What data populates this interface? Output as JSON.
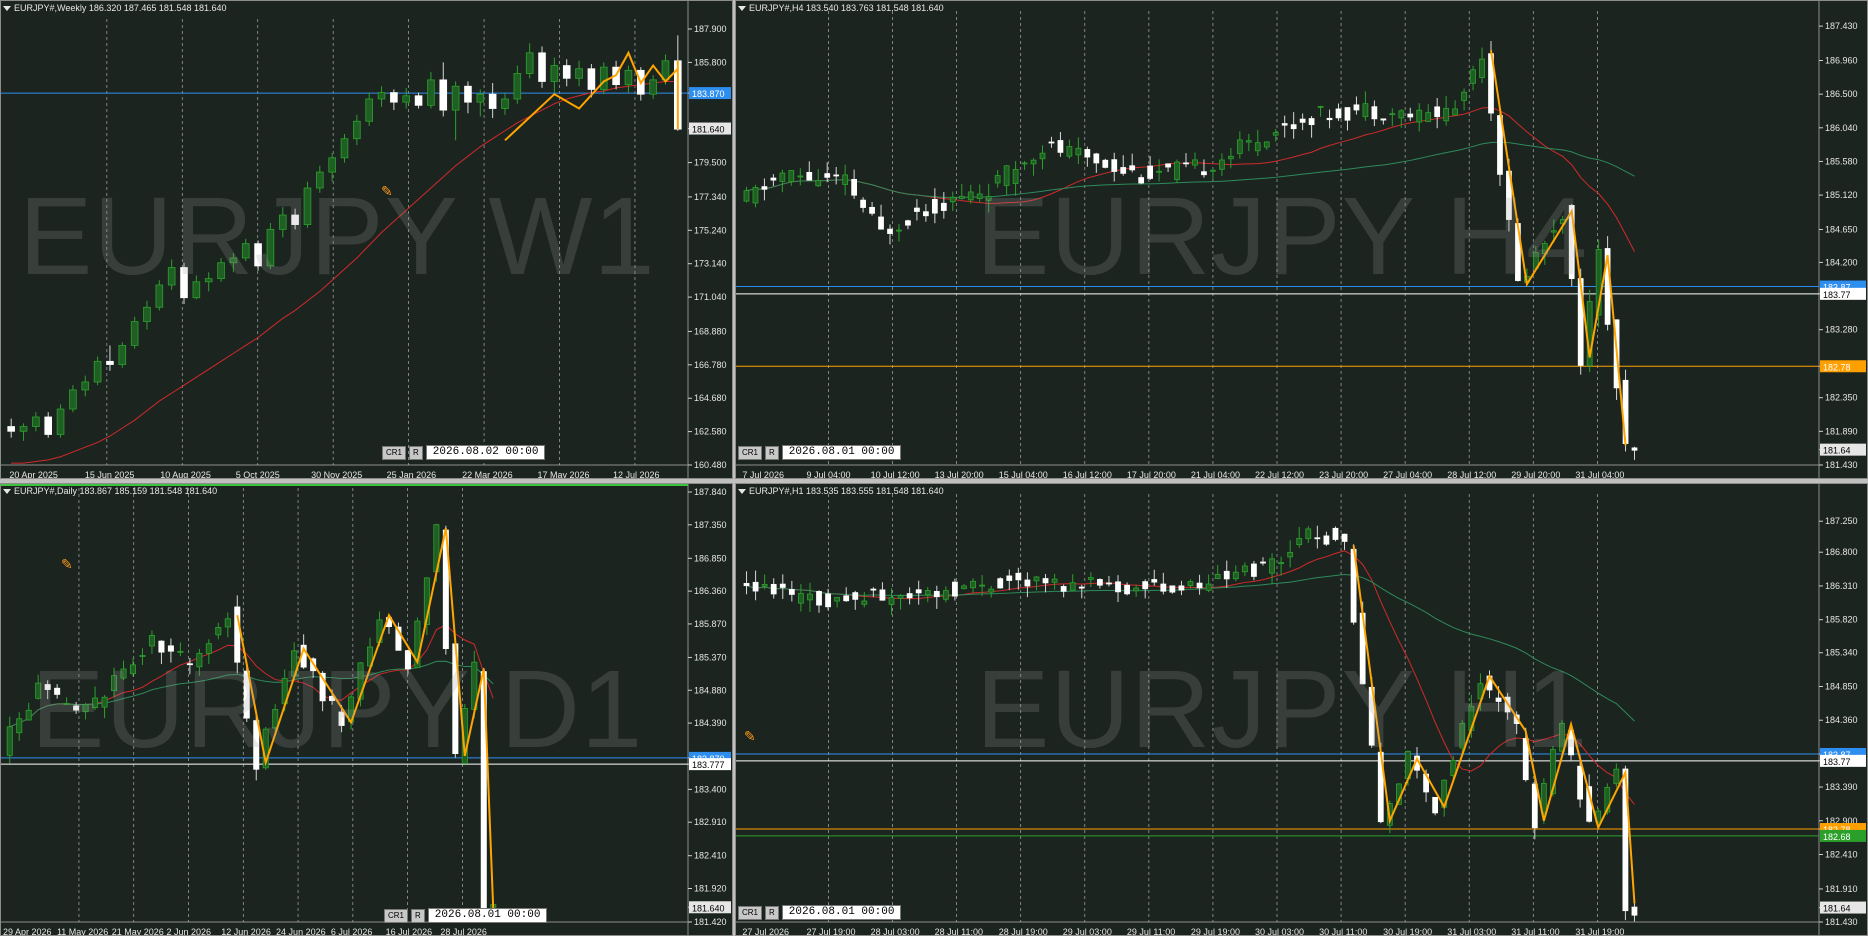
{
  "charts": [
    {
      "id": "w1",
      "header": "EURJPY#,Weekly  186.320 187.465 181.548 181.640",
      "watermark": "EURJPY W1",
      "nav": {
        "btn1": "CR1",
        "btn2": "R",
        "datetime": "2026.08.02 00:00"
      },
      "ylim": [
        160.48,
        187.9
      ],
      "price_labels": [
        "187.900",
        "185.800",
        "183.870",
        "181.640",
        "179.500",
        "177.340",
        "175.240",
        "173.140",
        "171.040",
        "168.880",
        "166.780",
        "164.680",
        "162.580",
        "160.480"
      ],
      "x_labels": [
        "20 Apr 2025",
        "15 Jun 2025",
        "10 Aug 2025",
        "5 Oct 2025",
        "30 Nov 2025",
        "25 Jan 2026",
        "22 Mar 2026",
        "17 May 2026",
        "12 Jul 2026"
      ],
      "hlines": [
        {
          "price": 183.87,
          "color": "#2e8ef0",
          "label": "183.870"
        }
      ],
      "current_price": {
        "price": 181.64,
        "label": "181.640"
      },
      "candles": [
        [
          162.9,
          163.4,
          162.2,
          162.6
        ],
        [
          162.6,
          163.1,
          162.0,
          162.9
        ],
        [
          162.9,
          163.8,
          162.6,
          163.5
        ],
        [
          163.5,
          163.8,
          162.2,
          162.4
        ],
        [
          162.4,
          164.3,
          162.2,
          164.0
        ],
        [
          164.0,
          165.5,
          163.8,
          165.2
        ],
        [
          165.2,
          166.1,
          164.8,
          165.7
        ],
        [
          165.7,
          167.3,
          165.5,
          167.0
        ],
        [
          167.0,
          168.0,
          166.4,
          166.8
        ],
        [
          166.8,
          168.2,
          166.6,
          168.0
        ],
        [
          168.0,
          169.8,
          167.8,
          169.5
        ],
        [
          169.5,
          170.8,
          169.0,
          170.4
        ],
        [
          170.4,
          172.1,
          170.2,
          171.8
        ],
        [
          171.8,
          173.4,
          171.5,
          172.9
        ],
        [
          172.9,
          173.2,
          170.6,
          171.0
        ],
        [
          171.0,
          172.4,
          170.9,
          172.0
        ],
        [
          172.0,
          172.6,
          171.4,
          172.2
        ],
        [
          172.2,
          173.5,
          172.0,
          173.2
        ],
        [
          173.2,
          173.8,
          172.6,
          173.5
        ],
        [
          173.5,
          174.7,
          173.3,
          174.4
        ],
        [
          174.4,
          174.6,
          172.7,
          173.0
        ],
        [
          173.0,
          175.7,
          172.8,
          175.3
        ],
        [
          175.3,
          176.7,
          174.8,
          176.2
        ],
        [
          176.2,
          176.6,
          175.3,
          175.6
        ],
        [
          175.6,
          178.3,
          175.4,
          177.9
        ],
        [
          177.9,
          179.3,
          177.6,
          178.9
        ],
        [
          178.9,
          180.1,
          178.3,
          179.8
        ],
        [
          179.8,
          181.3,
          179.5,
          181.0
        ],
        [
          181.0,
          182.5,
          180.6,
          182.1
        ],
        [
          182.1,
          183.9,
          181.8,
          183.5
        ],
        [
          183.5,
          184.3,
          183.0,
          183.9
        ],
        [
          183.9,
          184.1,
          182.8,
          183.3
        ],
        [
          183.3,
          184.2,
          182.9,
          183.7
        ],
        [
          183.7,
          183.9,
          182.9,
          183.1
        ],
        [
          183.1,
          185.2,
          182.9,
          184.7
        ],
        [
          184.7,
          185.8,
          182.4,
          182.8
        ],
        [
          182.8,
          184.6,
          180.9,
          184.3
        ],
        [
          184.3,
          184.6,
          182.6,
          183.3
        ],
        [
          183.3,
          184.1,
          182.4,
          183.8
        ],
        [
          183.8,
          184.5,
          182.3,
          182.9
        ],
        [
          182.9,
          183.9,
          182.5,
          183.5
        ],
        [
          183.5,
          185.6,
          183.2,
          185.1
        ],
        [
          185.1,
          187.0,
          184.8,
          186.4
        ],
        [
          186.4,
          186.8,
          184.2,
          184.6
        ],
        [
          184.6,
          186.1,
          183.9,
          185.6
        ],
        [
          185.6,
          186.0,
          184.3,
          184.8
        ],
        [
          184.8,
          185.9,
          184.3,
          185.4
        ],
        [
          185.4,
          185.7,
          183.6,
          184.1
        ],
        [
          184.1,
          185.8,
          183.8,
          185.5
        ],
        [
          185.5,
          185.9,
          184.1,
          184.4
        ],
        [
          184.4,
          185.6,
          183.9,
          185.3
        ],
        [
          185.3,
          185.5,
          183.4,
          183.8
        ],
        [
          183.8,
          185.0,
          183.5,
          184.7
        ],
        [
          184.7,
          186.3,
          184.4,
          185.9
        ],
        [
          185.9,
          187.5,
          181.5,
          181.6
        ]
      ],
      "ma": [
        {
          "color": "#d02a2a",
          "values": [
            160.6,
            160.6,
            160.7,
            160.8,
            161.0,
            161.3,
            161.6,
            161.9,
            162.3,
            162.8,
            163.3,
            163.9,
            164.5,
            165.0,
            165.5,
            166.0,
            166.5,
            167.0,
            167.5,
            168.0,
            168.5,
            169.1,
            169.7,
            170.2,
            170.8,
            171.4,
            172.1,
            172.8,
            173.5,
            174.3,
            175.1,
            175.8,
            176.5,
            177.2,
            177.9,
            178.6,
            179.3,
            179.9,
            180.5,
            181.0,
            181.5,
            182.0,
            182.4,
            182.8,
            183.2,
            183.5,
            183.7,
            183.9,
            184.0,
            184.2,
            184.3,
            184.4,
            184.5,
            184.6,
            184.6
          ]
        }
      ],
      "zigzag": [
        [
          40,
          180.9
        ],
        [
          44,
          183.8
        ],
        [
          46,
          182.9
        ],
        [
          48,
          184.6
        ],
        [
          49,
          185.0
        ],
        [
          50,
          186.4
        ],
        [
          51,
          184.5
        ],
        [
          52,
          185.6
        ],
        [
          53,
          184.6
        ],
        [
          54,
          185.4
        ],
        [
          55,
          184.5
        ],
        [
          56,
          185.8
        ],
        [
          57,
          184.8
        ],
        [
          58,
          185.9
        ],
        [
          59,
          181.6
        ]
      ]
    },
    {
      "id": "h4",
      "header": "EURJPY#,H4  183.540 183.763 181.548 181.640",
      "watermark": "EURJPY H4",
      "nav": {
        "btn1": "CR1",
        "btn2": "R",
        "datetime": "2026.08.01 00:00"
      },
      "ylim": [
        181.43,
        187.5
      ],
      "price_labels": [
        "187.430",
        "186.960",
        "186.500",
        "186.040",
        "185.580",
        "185.120",
        "184.650",
        "184.200",
        "183.770",
        "183.280",
        "182.780",
        "182.350",
        "181.890",
        "181.640",
        "181.430"
      ],
      "x_labels": [
        "7 Jul 2026",
        "9 Jul 04:00",
        "10 Jul 12:00",
        "13 Jul 20:00",
        "15 Jul 04:00",
        "16 Jul 12:00",
        "17 Jul 20:00",
        "21 Jul 04:00",
        "22 Jul 12:00",
        "23 Jul 20:00",
        "27 Jul 04:00",
        "28 Jul 12:00",
        "29 Jul 20:00",
        "31 Jul 04:00"
      ],
      "hlines": [
        {
          "price": 183.87,
          "color": "#2e8ef0",
          "label": "183.87"
        },
        {
          "price": 183.77,
          "color": "#ffffff",
          "label": "183.77"
        },
        {
          "price": 182.78,
          "color": "#ffa000",
          "label": "182.78"
        }
      ],
      "current_price": {
        "price": 181.64,
        "label": "181.64"
      },
      "candles_desc": "series",
      "zigzag": [
        [
          83,
          187.1
        ],
        [
          87,
          183.9
        ],
        [
          92,
          184.9
        ],
        [
          94,
          182.9
        ],
        [
          96,
          184.3
        ],
        [
          98,
          181.7
        ]
      ]
    },
    {
      "id": "d1",
      "header": "EURJPY#,Daily  183.867 185.159 181.548 181.640",
      "watermark": "EURJPY D1",
      "nav": {
        "btn1": "CR1",
        "btn2": "R",
        "datetime": "2026.08.01 00:00"
      },
      "ylim": [
        181.42,
        187.84
      ],
      "price_labels": [
        "187.840",
        "187.350",
        "186.850",
        "186.360",
        "185.870",
        "185.370",
        "184.880",
        "184.390",
        "183.870",
        "183.777",
        "183.400",
        "182.910",
        "182.410",
        "181.920",
        "181.640",
        "181.420"
      ],
      "x_labels": [
        "29 Apr 2026",
        "11 May 2026",
        "21 May 2026",
        "2 Jun 2026",
        "12 Jun 2026",
        "24 Jun 2026",
        "6 Jul 2026",
        "16 Jul 2026",
        "28 Jul 2026"
      ],
      "hlines": [
        {
          "price": 183.87,
          "color": "#2e8ef0",
          "label": "183.870"
        },
        {
          "price": 183.777,
          "color": "#ffffff",
          "label": "183.777"
        }
      ],
      "current_price": {
        "price": 181.64,
        "label": "181.640"
      },
      "zigzag": [
        [
          24,
          186.0
        ],
        [
          27,
          183.8
        ],
        [
          31,
          185.5
        ],
        [
          36,
          184.4
        ],
        [
          40,
          186.0
        ],
        [
          43,
          185.3
        ],
        [
          46,
          187.3
        ],
        [
          48,
          183.9
        ],
        [
          50,
          185.2
        ],
        [
          51,
          181.6
        ]
      ]
    },
    {
      "id": "h1",
      "header": "EURJPY#,H1  183.535 183.555 181.548 181.640",
      "watermark": "EURJPY H1",
      "nav": {
        "btn1": "CR1",
        "btn2": "R",
        "datetime": "2026.08.01 00:00"
      },
      "ylim": [
        181.43,
        187.5
      ],
      "price_labels": [
        "187.250",
        "186.800",
        "186.310",
        "185.820",
        "185.340",
        "184.850",
        "184.360",
        "183.870",
        "183.770",
        "183.390",
        "182.900",
        "182.780",
        "182.410",
        "181.910",
        "181.640",
        "181.430"
      ],
      "x_labels": [
        "27 Jul 2026",
        "27 Jul 19:00",
        "28 Jul 03:00",
        "28 Jul 11:00",
        "28 Jul 19:00",
        "29 Jul 03:00",
        "29 Jul 11:00",
        "29 Jul 19:00",
        "30 Jul 03:00",
        "30 Jul 11:00",
        "30 Jul 19:00",
        "31 Jul 03:00",
        "31 Jul 11:00",
        "31 Jul 19:00"
      ],
      "hlines": [
        {
          "price": 183.87,
          "color": "#2e8ef0",
          "label": "183.87"
        },
        {
          "price": 183.77,
          "color": "#ffffff",
          "label": "183.77"
        },
        {
          "price": 182.78,
          "color": "#ffa000",
          "label": "182.78"
        },
        {
          "price": 182.68,
          "color": "#2aa02a",
          "label": "182.68"
        }
      ],
      "current_price": {
        "price": 181.64,
        "label": "181.64"
      },
      "zigzag": [
        [
          67,
          186.9
        ],
        [
          71,
          182.9
        ],
        [
          74,
          183.8
        ],
        [
          77,
          183.1
        ],
        [
          82,
          185.0
        ],
        [
          86,
          184.2
        ],
        [
          88,
          182.9
        ],
        [
          91,
          184.3
        ],
        [
          94,
          182.8
        ],
        [
          97,
          183.6
        ],
        [
          98,
          181.7
        ]
      ]
    }
  ]
}
